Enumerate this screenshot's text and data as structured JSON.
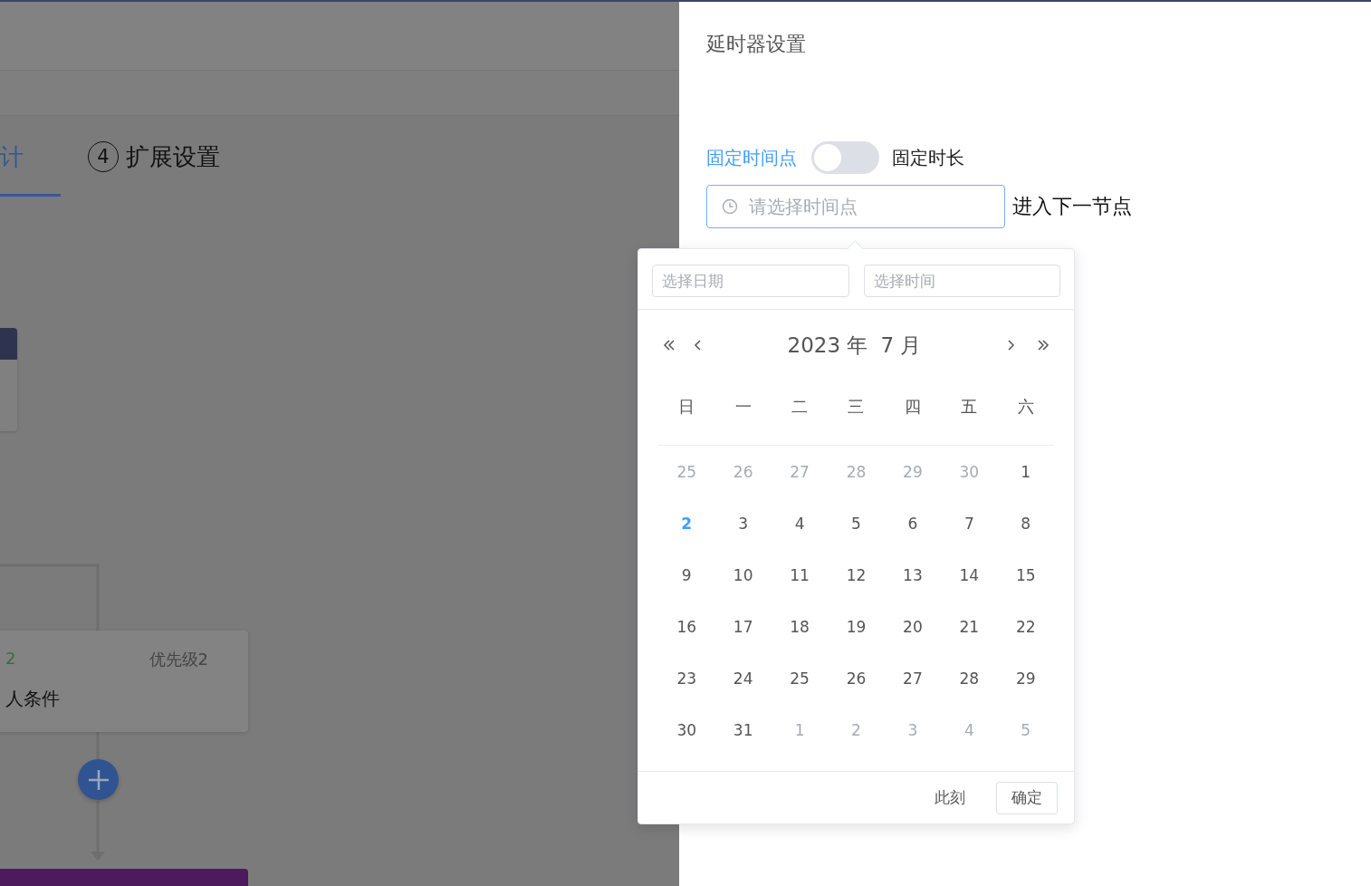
{
  "background": {
    "tabs": [
      {
        "label": "计",
        "selected": true
      },
      {
        "number": "4",
        "label": "扩展设置",
        "selected": false
      }
    ],
    "flow": {
      "condition_card": {
        "name": "2",
        "priority": "优先级2",
        "description": "人条件"
      }
    }
  },
  "drawer": {
    "title": "延时器设置",
    "mode_switch": {
      "off_label": "固定时间点",
      "on_label": "固定时长",
      "on": false
    },
    "time_field": {
      "placeholder": "请选择时间点",
      "focused": true
    },
    "after_text": "进入下一节点"
  },
  "picker": {
    "date_field": {
      "placeholder": "选择日期"
    },
    "time_field": {
      "placeholder": "选择时间"
    },
    "year": "2023 年",
    "month": "7 月",
    "weekdays": [
      "日",
      "一",
      "二",
      "三",
      "四",
      "五",
      "六"
    ],
    "days": [
      {
        "label": "25",
        "in_month": false,
        "today": false
      },
      {
        "label": "26",
        "in_month": false,
        "today": false
      },
      {
        "label": "27",
        "in_month": false,
        "today": false
      },
      {
        "label": "28",
        "in_month": false,
        "today": false
      },
      {
        "label": "29",
        "in_month": false,
        "today": false
      },
      {
        "label": "30",
        "in_month": false,
        "today": false
      },
      {
        "label": "1",
        "in_month": true,
        "today": false
      },
      {
        "label": "2",
        "in_month": true,
        "today": true
      },
      {
        "label": "3",
        "in_month": true,
        "today": false
      },
      {
        "label": "4",
        "in_month": true,
        "today": false
      },
      {
        "label": "5",
        "in_month": true,
        "today": false
      },
      {
        "label": "6",
        "in_month": true,
        "today": false
      },
      {
        "label": "7",
        "in_month": true,
        "today": false
      },
      {
        "label": "8",
        "in_month": true,
        "today": false
      },
      {
        "label": "9",
        "in_month": true,
        "today": false
      },
      {
        "label": "10",
        "in_month": true,
        "today": false
      },
      {
        "label": "11",
        "in_month": true,
        "today": false
      },
      {
        "label": "12",
        "in_month": true,
        "today": false
      },
      {
        "label": "13",
        "in_month": true,
        "today": false
      },
      {
        "label": "14",
        "in_month": true,
        "today": false
      },
      {
        "label": "15",
        "in_month": true,
        "today": false
      },
      {
        "label": "16",
        "in_month": true,
        "today": false
      },
      {
        "label": "17",
        "in_month": true,
        "today": false
      },
      {
        "label": "18",
        "in_month": true,
        "today": false
      },
      {
        "label": "19",
        "in_month": true,
        "today": false
      },
      {
        "label": "20",
        "in_month": true,
        "today": false
      },
      {
        "label": "21",
        "in_month": true,
        "today": false
      },
      {
        "label": "22",
        "in_month": true,
        "today": false
      },
      {
        "label": "23",
        "in_month": true,
        "today": false
      },
      {
        "label": "24",
        "in_month": true,
        "today": false
      },
      {
        "label": "25",
        "in_month": true,
        "today": false
      },
      {
        "label": "26",
        "in_month": true,
        "today": false
      },
      {
        "label": "27",
        "in_month": true,
        "today": false
      },
      {
        "label": "28",
        "in_month": true,
        "today": false
      },
      {
        "label": "29",
        "in_month": true,
        "today": false
      },
      {
        "label": "30",
        "in_month": true,
        "today": false
      },
      {
        "label": "31",
        "in_month": true,
        "today": false
      },
      {
        "label": "1",
        "in_month": false,
        "today": false
      },
      {
        "label": "2",
        "in_month": false,
        "today": false
      },
      {
        "label": "3",
        "in_month": false,
        "today": false
      },
      {
        "label": "4",
        "in_month": false,
        "today": false
      },
      {
        "label": "5",
        "in_month": false,
        "today": false
      }
    ],
    "now_link": "此刻",
    "confirm_button": "确定"
  }
}
